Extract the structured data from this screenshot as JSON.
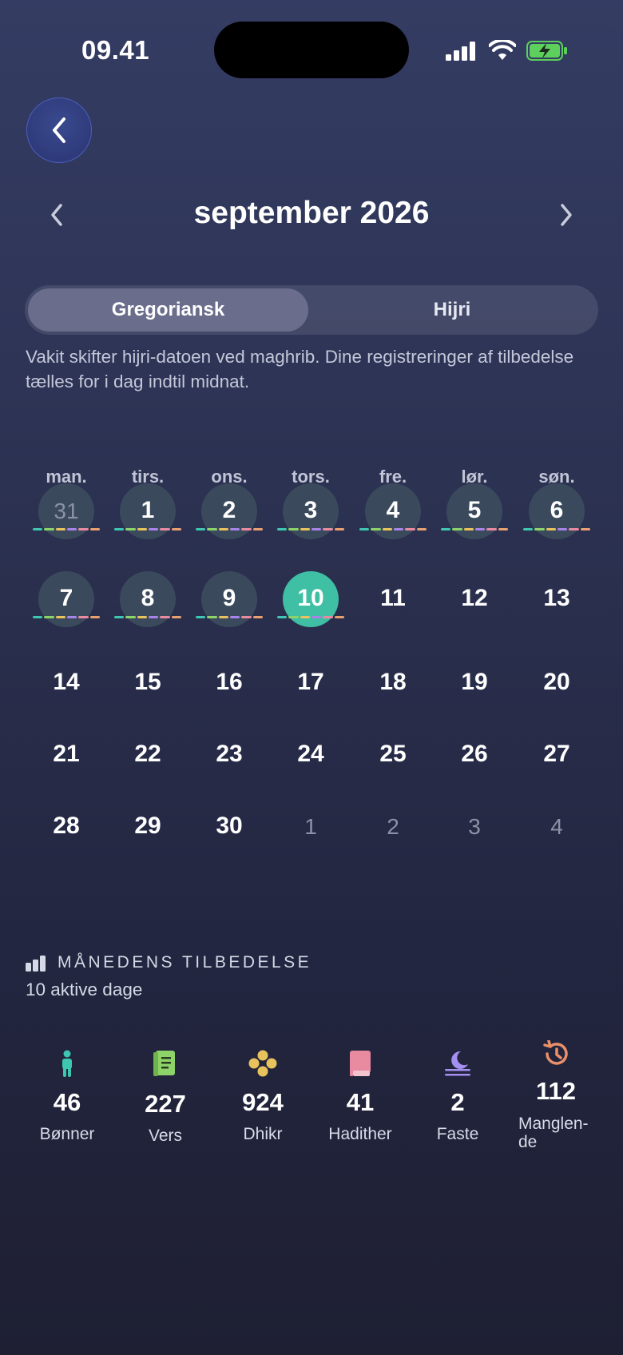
{
  "status_bar": {
    "time": "09.41"
  },
  "header": {
    "month_title": "september 2026"
  },
  "segment": {
    "active": "Gregoriansk",
    "inactive": "Hijri"
  },
  "note": "Vakit skifter hijri-datoen ved maghrib. Dine registreringer af tilbedelse tælles for i dag indtil midnat.",
  "weekdays": [
    "man.",
    "tirs.",
    "ons.",
    "tors.",
    "fre.",
    "lør.",
    "søn."
  ],
  "calendar_weeks": [
    [
      "31",
      "1",
      "2",
      "3",
      "4",
      "5",
      "6"
    ],
    [
      "7",
      "8",
      "9",
      "10",
      "11",
      "12",
      "13"
    ],
    [
      "14",
      "15",
      "16",
      "17",
      "18",
      "19",
      "20"
    ],
    [
      "21",
      "22",
      "23",
      "24",
      "25",
      "26",
      "27"
    ],
    [
      "28",
      "29",
      "30",
      "1",
      "2",
      "3",
      "4"
    ]
  ],
  "today": "10",
  "marker_colors": [
    "#3ec6b0",
    "#8ed36a",
    "#e8c25c",
    "#a884e8",
    "#e88aa0",
    "#e8a070"
  ],
  "summary": {
    "title": "MÅNEDENS TILBEDELSE",
    "subtitle": "10 aktive dage",
    "stats": [
      {
        "icon": "person-icon",
        "value": "46",
        "label": "Bønner",
        "color": "#3ec6b0"
      },
      {
        "icon": "book-icon",
        "value": "227",
        "label": "Vers",
        "color": "#8ed36a"
      },
      {
        "icon": "beads-icon",
        "value": "924",
        "label": "Dhikr",
        "color": "#e8c25c"
      },
      {
        "icon": "hadith-book-icon",
        "value": "41",
        "label": "Hadither",
        "color": "#e88aa0"
      },
      {
        "icon": "moon-icon",
        "value": "2",
        "label": "Faste",
        "color": "#a58ff0"
      },
      {
        "icon": "history-icon",
        "value": "112",
        "label": "Manglen-\nde",
        "color": "#e8906a"
      }
    ]
  }
}
